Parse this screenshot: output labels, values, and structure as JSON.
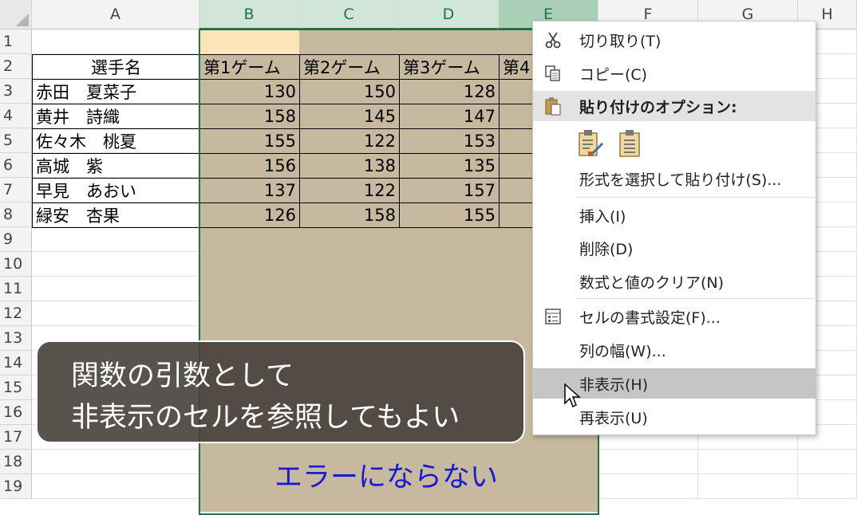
{
  "columns": [
    "A",
    "B",
    "C",
    "D",
    "E",
    "F",
    "G",
    "H"
  ],
  "rows": [
    "1",
    "2",
    "3",
    "4",
    "5",
    "6",
    "7",
    "8",
    "9",
    "10",
    "11",
    "12",
    "13",
    "14",
    "15",
    "16",
    "17",
    "18",
    "19"
  ],
  "table": {
    "header_name": "選手名",
    "game_headers": [
      "第1ゲーム",
      "第2ゲーム",
      "第3ゲーム",
      "第4"
    ],
    "players": [
      {
        "name": "赤田　夏菜子",
        "scores": [
          130,
          150,
          128
        ]
      },
      {
        "name": "黄井　詩織",
        "scores": [
          158,
          145,
          147
        ]
      },
      {
        "name": "佐々木　桃夏",
        "scores": [
          155,
          122,
          153
        ]
      },
      {
        "name": "高城　紫",
        "scores": [
          156,
          138,
          135
        ]
      },
      {
        "name": "早見　あおい",
        "scores": [
          137,
          122,
          157
        ]
      },
      {
        "name": "緑安　杏果",
        "scores": [
          126,
          158,
          155
        ]
      }
    ]
  },
  "context_menu": {
    "cut": "切り取り(T)",
    "copy": "コピー(C)",
    "paste_options": "貼り付けのオプション:",
    "paste_special": "形式を選択して貼り付け(S)...",
    "insert": "挿入(I)",
    "delete": "削除(D)",
    "clear": "数式と値のクリア(N)",
    "format_cells": "セルの書式設定(F)...",
    "column_width": "列の幅(W)...",
    "hide": "非表示(H)",
    "unhide": "再表示(U)"
  },
  "overlay": {
    "line1": "関数の引数として",
    "line2": "非表示のセルを参照してもよい"
  },
  "note": "エラーにならない",
  "colors": {
    "selection": "#217346",
    "shade": "#c7b9a0",
    "note": "#1a1ad0"
  }
}
